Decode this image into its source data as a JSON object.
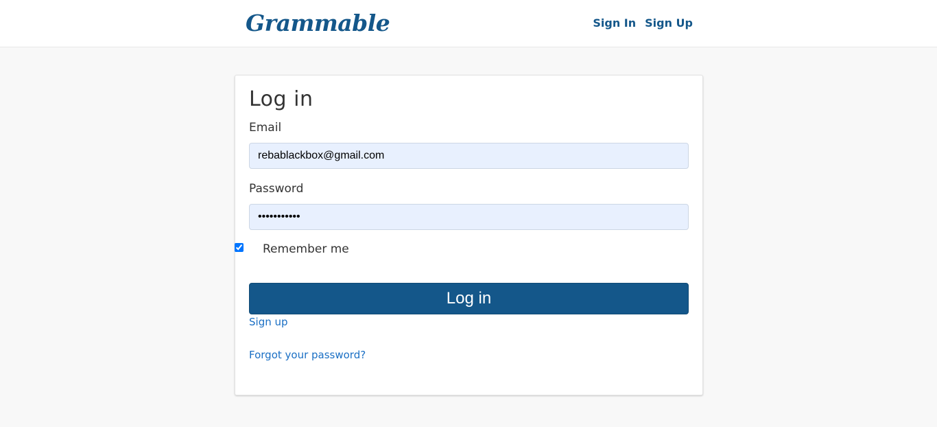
{
  "navbar": {
    "brand": "Grammable",
    "links": [
      "Sign In",
      "Sign Up"
    ]
  },
  "form": {
    "title": "Log in",
    "email_label": "Email",
    "email_value": "rebablackbox@gmail.com",
    "password_label": "Password",
    "password_value": "•••••••••••",
    "remember_label": "Remember me",
    "remember_checked": true,
    "submit_label": "Log in"
  },
  "links": {
    "sign_up": "Sign up",
    "forgot_password": "Forgot your password?"
  },
  "colors": {
    "brand": "#14578a",
    "link": "#1a6fc4",
    "input_bg": "#e8f0fe",
    "page_bg": "#f8f8f8"
  }
}
